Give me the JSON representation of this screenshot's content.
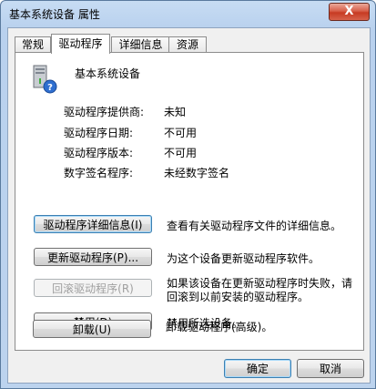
{
  "window": {
    "title": "基本系统设备 属性",
    "close_glyph": "X"
  },
  "tabs": [
    {
      "label": "常规"
    },
    {
      "label": "驱动程序"
    },
    {
      "label": "详细信息"
    },
    {
      "label": "资源"
    }
  ],
  "device": {
    "name": "基本系统设备",
    "icon": "device-question-icon"
  },
  "driver_info": [
    {
      "label": "驱动程序提供商:",
      "value": "未知"
    },
    {
      "label": "驱动程序日期:",
      "value": "不可用"
    },
    {
      "label": "驱动程序版本:",
      "value": "不可用"
    },
    {
      "label": "数字签名程序:",
      "value": "未经数字签名"
    }
  ],
  "actions": [
    {
      "label": "驱动程序详细信息(I)",
      "desc": "查看有关驱动程序文件的详细信息。",
      "desc2": ""
    },
    {
      "label": "更新驱动程序(P)...",
      "desc": "为这个设备更新驱动程序软件。",
      "desc2": ""
    },
    {
      "label": "回滚驱动程序(R)",
      "desc": "如果该设备在更新驱动程序时失败，请",
      "desc2": "回滚到以前安装的驱动程序。"
    },
    {
      "label": "禁用(D)",
      "desc": "禁用所选设备。",
      "desc2": ""
    },
    {
      "label": "卸载(U)",
      "desc": "卸载驱动程序(高级)。",
      "desc2": ""
    }
  ],
  "footer": {
    "ok": "确定",
    "cancel": "取消"
  }
}
